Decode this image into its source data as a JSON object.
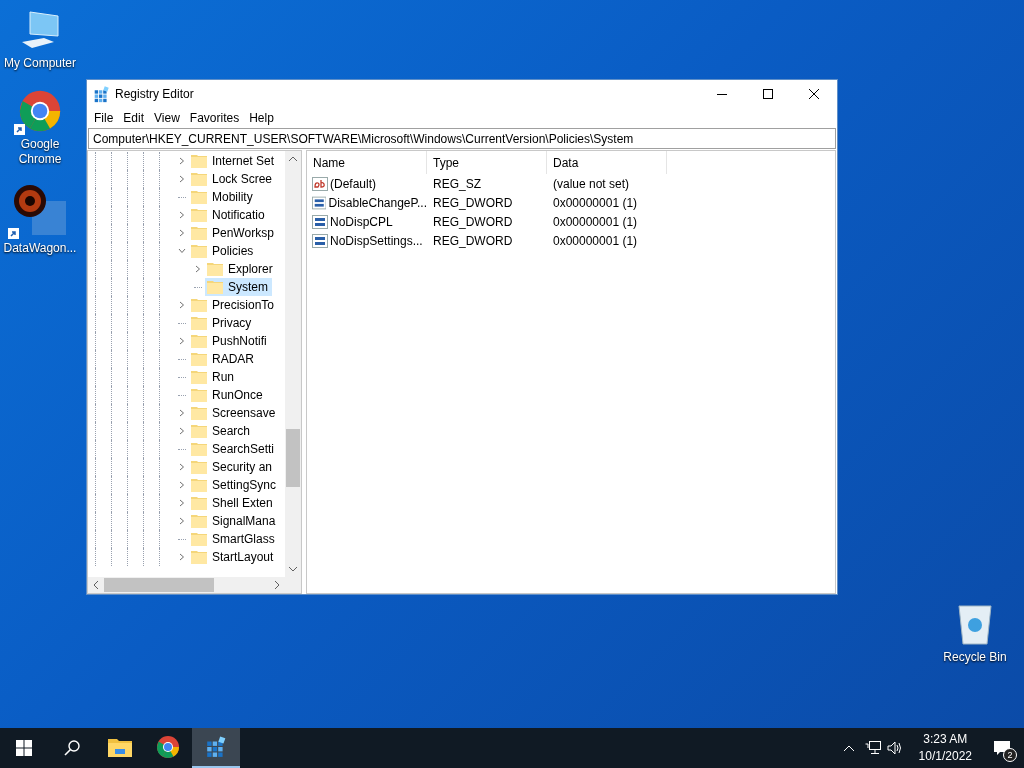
{
  "desktop_icons": [
    {
      "kind": "computer",
      "label": "My Computer"
    },
    {
      "kind": "chrome",
      "label": "Google Chrome",
      "shortcut": true
    },
    {
      "kind": "datawagon",
      "label": "DataWagon...",
      "shortcut": true
    },
    {
      "kind": "recycle",
      "label": "Recycle Bin",
      "shortcut": false
    }
  ],
  "window": {
    "title": "Registry Editor",
    "menu": [
      "File",
      "Edit",
      "View",
      "Favorites",
      "Help"
    ],
    "address": "Computer\\HKEY_CURRENT_USER\\SOFTWARE\\Microsoft\\Windows\\CurrentVersion\\Policies\\System",
    "tree": [
      {
        "label": "Internet Set",
        "expandable": true,
        "expanded": false,
        "selected": false
      },
      {
        "label": "Lock Scree",
        "expandable": true,
        "expanded": false,
        "selected": false
      },
      {
        "label": "Mobility",
        "expandable": false,
        "selected": false
      },
      {
        "label": "Notificatio",
        "expandable": true,
        "expanded": false,
        "selected": false
      },
      {
        "label": "PenWorksp",
        "expandable": true,
        "expanded": false,
        "selected": false
      },
      {
        "label": "Policies",
        "expandable": true,
        "expanded": true,
        "selected": false,
        "children": [
          {
            "label": "Explorer",
            "expandable": true,
            "expanded": false,
            "selected": false
          },
          {
            "label": "System",
            "expandable": false,
            "selected": true
          }
        ]
      },
      {
        "label": "PrecisionTo",
        "expandable": true,
        "expanded": false,
        "selected": false
      },
      {
        "label": "Privacy",
        "expandable": false,
        "selected": false
      },
      {
        "label": "PushNotifi",
        "expandable": true,
        "expanded": false,
        "selected": false
      },
      {
        "label": "RADAR",
        "expandable": false,
        "selected": false
      },
      {
        "label": "Run",
        "expandable": false,
        "selected": false
      },
      {
        "label": "RunOnce",
        "expandable": false,
        "selected": false
      },
      {
        "label": "Screensave",
        "expandable": true,
        "expanded": false,
        "selected": false
      },
      {
        "label": "Search",
        "expandable": true,
        "expanded": false,
        "selected": false
      },
      {
        "label": "SearchSetti",
        "expandable": false,
        "selected": false
      },
      {
        "label": "Security an",
        "expandable": true,
        "expanded": false,
        "selected": false
      },
      {
        "label": "SettingSync",
        "expandable": true,
        "expanded": false,
        "selected": false
      },
      {
        "label": "Shell Exten",
        "expandable": true,
        "expanded": false,
        "selected": false
      },
      {
        "label": "SignalMana",
        "expandable": true,
        "expanded": false,
        "selected": false
      },
      {
        "label": "SmartGlass",
        "expandable": false,
        "selected": false
      },
      {
        "label": "StartLayout",
        "expandable": true,
        "expanded": false,
        "selected": false
      }
    ],
    "columns": [
      "Name",
      "Type",
      "Data"
    ],
    "rows": [
      {
        "kind": "string",
        "name": "(Default)",
        "type": "REG_SZ",
        "data": "(value not set)"
      },
      {
        "kind": "binary",
        "name": "DisableChangeP...",
        "type": "REG_DWORD",
        "data": "0x00000001 (1)"
      },
      {
        "kind": "binary",
        "name": "NoDispCPL",
        "type": "REG_DWORD",
        "data": "0x00000001 (1)"
      },
      {
        "kind": "binary",
        "name": "NoDispSettings...",
        "type": "REG_DWORD",
        "data": "0x00000001 (1)"
      }
    ]
  },
  "taskbar": {
    "apps": [
      {
        "kind": "explorer",
        "active": false
      },
      {
        "kind": "chrome",
        "active": false
      },
      {
        "kind": "regedit",
        "active": true
      }
    ],
    "time": "3:23 AM",
    "date": "10/1/2022",
    "notifications": "2"
  }
}
